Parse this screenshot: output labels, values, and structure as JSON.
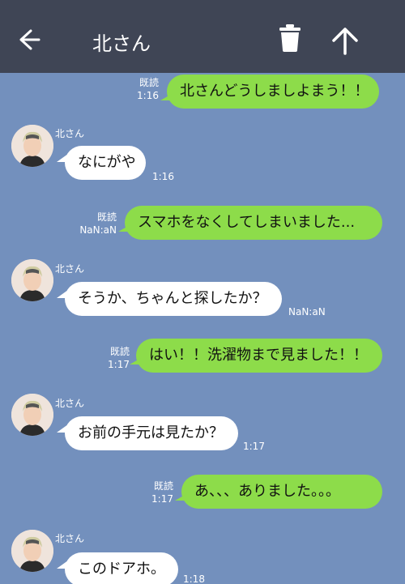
{
  "header": {
    "title": "北さん",
    "bg_color": "#3f4555"
  },
  "colors": {
    "chat_bg": "#7390bd",
    "outgoing_bubble": "#8ddc4a",
    "incoming_bubble": "#ffffff"
  },
  "messages": [
    {
      "dir": "out",
      "text": "北さんどうしましよまう！！",
      "read": "既読",
      "time": "1:16"
    },
    {
      "dir": "in",
      "sender": "北さん",
      "text": "なにがや",
      "time": "1:16"
    },
    {
      "dir": "out",
      "text": "スマホをなくしてしまいました...",
      "read": "既読",
      "time": "NaN:aN"
    },
    {
      "dir": "in",
      "sender": "北さん",
      "text": "そうか、ちゃんと探したか？",
      "time": "NaN:aN"
    },
    {
      "dir": "out",
      "text": "はい！！洗濯物まで見ました！！",
      "read": "既読",
      "time": "1:17"
    },
    {
      "dir": "in",
      "sender": "北さん",
      "text": "お前の手元は見たか？",
      "time": "1:17"
    },
    {
      "dir": "out",
      "text": "あ、、、ありました。。。",
      "read": "既読",
      "time": "1:17"
    },
    {
      "dir": "in",
      "sender": "北さん",
      "text": "このドアホ。",
      "time": "1:18"
    }
  ]
}
